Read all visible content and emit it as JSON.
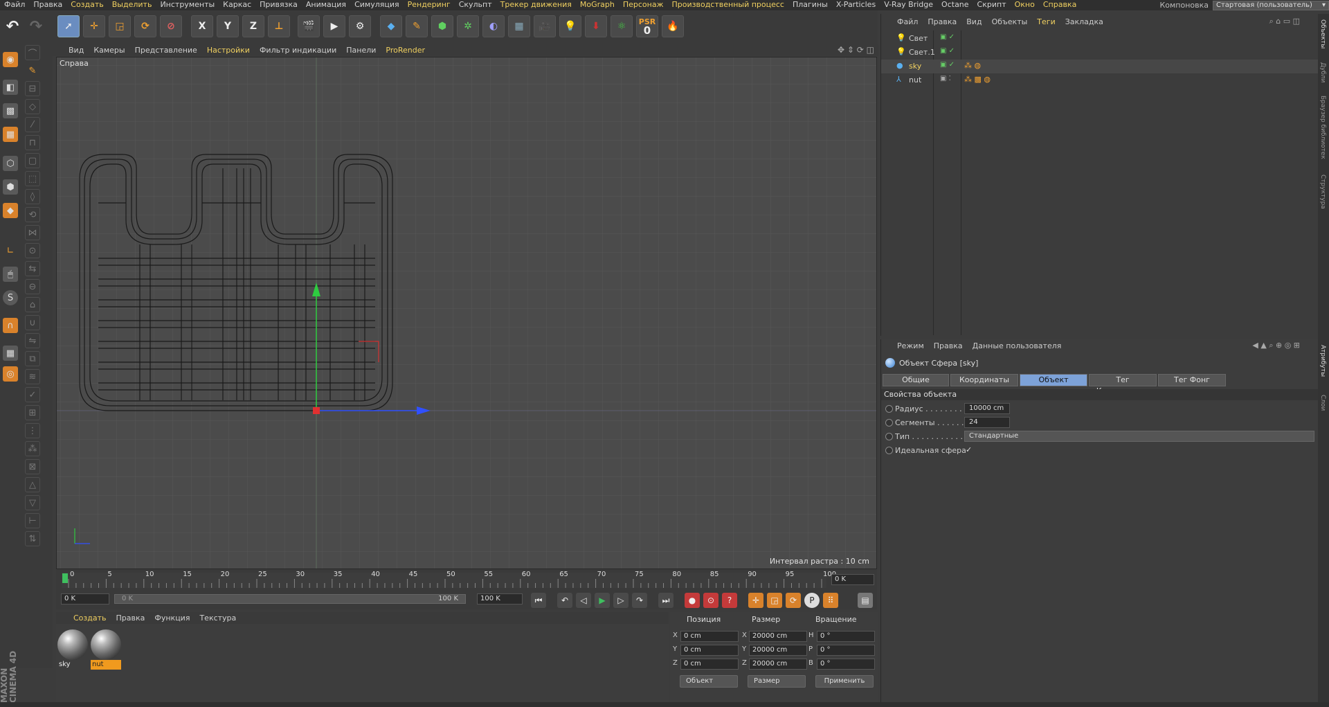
{
  "menubar": {
    "items": [
      "Файл",
      "Правка",
      "Создать",
      "Выделить",
      "Инструменты",
      "Каркас",
      "Привязка",
      "Анимация",
      "Симуляция",
      "Рендеринг",
      "Скульпт",
      "Трекер движения",
      "MoGraph",
      "Персонаж",
      "Производственный процесс",
      "Плагины",
      "X-Particles",
      "V-Ray Bridge",
      "Octane",
      "Скрипт",
      "Окно",
      "Справка"
    ],
    "layout_label": "Компоновка",
    "layout_value": "Стартовая (пользователь)"
  },
  "toolbar": {
    "axis_x": "X",
    "axis_y": "Y",
    "axis_z": "Z",
    "psr_label": "PSR",
    "psr_value": "0"
  },
  "viewport": {
    "menu": [
      "Вид",
      "Камеры",
      "Представление",
      "Настройки",
      "Фильтр индикации",
      "Панели",
      "ProRender"
    ],
    "view_name": "Справа",
    "raster_info": "Интервал растра : 10 cm"
  },
  "timeline": {
    "ticks": [
      "0",
      "5",
      "10",
      "15",
      "20",
      "25",
      "30",
      "35",
      "40",
      "45",
      "50",
      "55",
      "60",
      "65",
      "70",
      "75",
      "80",
      "85",
      "90",
      "95",
      "100"
    ],
    "current_frame": "0 K",
    "start_field": "0 K",
    "range_start": "0 K",
    "range_end": "100 K",
    "end_field": "100 K"
  },
  "materials": {
    "menu": [
      "Создать",
      "Правка",
      "Функция",
      "Текстура"
    ],
    "items": [
      {
        "name": "sky",
        "selected": false
      },
      {
        "name": "nut",
        "selected": true
      }
    ]
  },
  "coordinates": {
    "headers": [
      "Позиция",
      "Размер",
      "Вращение"
    ],
    "rows": [
      {
        "axis": "X",
        "pos": "0 cm",
        "size_axis": "X",
        "size": "20000 cm",
        "rot_axis": "H",
        "rot": "0 °"
      },
      {
        "axis": "Y",
        "pos": "0 cm",
        "size_axis": "Y",
        "size": "20000 cm",
        "rot_axis": "P",
        "rot": "0 °"
      },
      {
        "axis": "Z",
        "pos": "0 cm",
        "size_axis": "Z",
        "size": "20000 cm",
        "rot_axis": "B",
        "rot": "0 °"
      }
    ],
    "mode_select": "Объект",
    "size_select": "Размер",
    "apply_button": "Применить"
  },
  "object_manager": {
    "menu": [
      "Файл",
      "Правка",
      "Вид",
      "Объекты",
      "Теги",
      "Закладка"
    ],
    "objects": [
      {
        "name": "Свет",
        "active": false
      },
      {
        "name": "Свет.1",
        "active": false
      },
      {
        "name": "sky",
        "active": true
      },
      {
        "name": "nut",
        "active": false
      }
    ]
  },
  "attributes": {
    "menu": [
      "Режим",
      "Правка",
      "Данные пользователя"
    ],
    "title": "Объект Сфера [sky]",
    "tabs": [
      "Общие",
      "Координаты",
      "Объект",
      "Тег Композитинг",
      "Тег Фонг"
    ],
    "active_tab": "Объект",
    "section": "Свойства объекта",
    "props": [
      {
        "label": "Радиус . . . . . . . . .",
        "value": "10000 cm"
      },
      {
        "label": "Сегменты . . . . . .",
        "value": "24"
      },
      {
        "label": "Тип . . . . . . . . . . . .",
        "value": "Стандартные"
      },
      {
        "label": "Идеальная сфера",
        "value": "✓"
      }
    ]
  },
  "side_tabs": [
    "Объекты",
    "Дубли",
    "Браузер библиотек",
    "Структура",
    "Атрибуты",
    "Слои"
  ],
  "brand": "MAXON CINEMA 4D"
}
